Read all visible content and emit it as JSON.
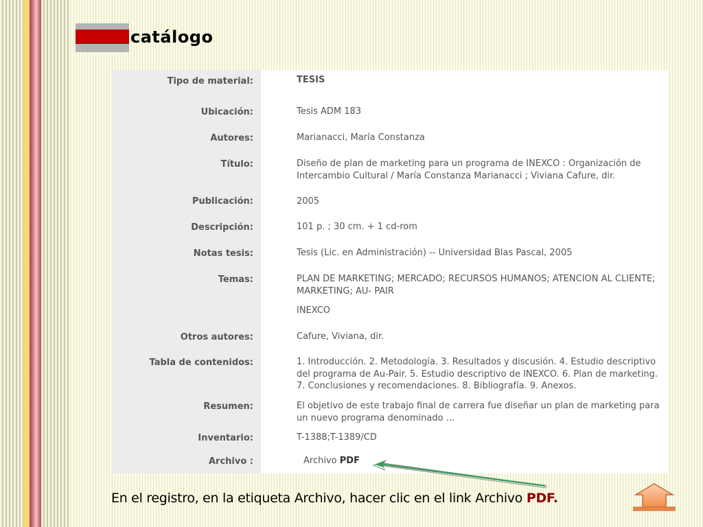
{
  "header": {
    "title": "catálogo"
  },
  "record": {
    "fields": [
      {
        "label": "Tipo de material:",
        "value": "TESIS"
      },
      {
        "label": "Ubicación:",
        "value": "Tesis ADM 183"
      },
      {
        "label": "Autores:",
        "value": "Marianacci, María Constanza"
      },
      {
        "label": "Título:",
        "value": "Diseño de plan de marketing para un  programa de INEXCO : Organización de Intercambio Cultural / María Constanza Marianacci ; Viviana Cafure, dir."
      },
      {
        "label": "Publicación:",
        "value": "2005"
      },
      {
        "label": "Descripción:",
        "value": "101 p. ; 30 cm. + 1 cd-rom"
      },
      {
        "label": "Notas tesis:",
        "value": "Tesis (Lic. en Administración) -- Universidad Blas Pascal, 2005"
      },
      {
        "label": "Temas:",
        "value": "PLAN DE MARKETING; MERCADO; RECURSOS HUMANOS; ATENCION AL CLIENTE; MARKETING; AU- PAIR",
        "value2": "INEXCO"
      },
      {
        "label": "Otros autores:",
        "value": "Cafure, Viviana, dir."
      },
      {
        "label": "Tabla de contenidos:",
        "value": "1. Introducción. 2. Metodología. 3. Resultados y discusión. 4. Estudio descriptivo del programa de Au-Pair. 5. Estudio descriptivo de INEXCO. 6. Plan de marketing. 7. Conclusiones y recomendaciones. 8. Bibliografía. 9. Anexos."
      },
      {
        "label": "Resumen:",
        "value": "El objetivo de este trabajo final de carrera fue diseñar un plan de marketing para un nuevo programa denominado ..."
      },
      {
        "label": "Inventario:",
        "value": "T-1388;T-1389/CD"
      },
      {
        "label": "Archivo :",
        "link_text": "Archivo",
        "link_bold": "PDF"
      }
    ]
  },
  "instruction": {
    "text": "En el registro, en la etiqueta Archivo, hacer clic en el link ",
    "link_word": "Archivo",
    "pdf": "PDF",
    "dot": "."
  },
  "colors": {
    "accent_red": "#c40000",
    "arrow_green": "#3a9a5a",
    "button_orange": "#f5a060"
  },
  "icons": {
    "nav_button": "up-arrow-icon"
  }
}
